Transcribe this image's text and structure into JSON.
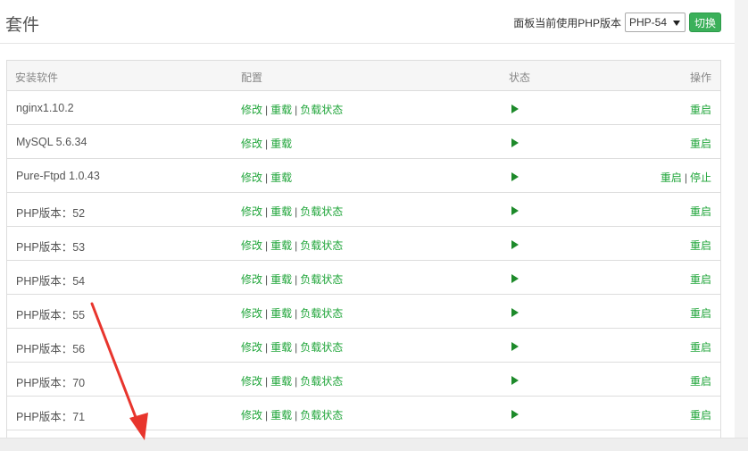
{
  "header": {
    "title": "套件",
    "php_label": "面板当前使用PHP版本",
    "php_selected": "PHP-54",
    "switch_label": "切换"
  },
  "table": {
    "columns": [
      "安装软件",
      "配置",
      "状态",
      "操作"
    ],
    "rows": [
      {
        "name": "nginx1.10.2",
        "config": [
          "修改",
          "重载",
          "负载状态"
        ],
        "ops": [
          "重启"
        ]
      },
      {
        "name": "MySQL 5.6.34",
        "config": [
          "修改",
          "重载"
        ],
        "ops": [
          "重启"
        ]
      },
      {
        "name": "Pure-Ftpd 1.0.43",
        "config": [
          "修改",
          "重载"
        ],
        "ops": [
          "重启",
          "停止"
        ]
      },
      {
        "name": "PHP版本：52",
        "config": [
          "修改",
          "重载",
          "负载状态"
        ],
        "ops": [
          "重启"
        ]
      },
      {
        "name": "PHP版本：53",
        "config": [
          "修改",
          "重载",
          "负载状态"
        ],
        "ops": [
          "重启"
        ]
      },
      {
        "name": "PHP版本：54",
        "config": [
          "修改",
          "重载",
          "负载状态"
        ],
        "ops": [
          "重启"
        ]
      },
      {
        "name": "PHP版本：55",
        "config": [
          "修改",
          "重载",
          "负载状态"
        ],
        "ops": [
          "重启"
        ]
      },
      {
        "name": "PHP版本：56",
        "config": [
          "修改",
          "重载",
          "负载状态"
        ],
        "ops": [
          "重启"
        ]
      },
      {
        "name": "PHP版本：70",
        "config": [
          "修改",
          "重载",
          "负载状态"
        ],
        "ops": [
          "重启"
        ]
      },
      {
        "name": "PHP版本：71",
        "config": [
          "修改",
          "重载",
          "负载状态"
        ],
        "ops": [
          "重启"
        ]
      }
    ]
  },
  "colors": {
    "link_green": "#20a53a",
    "button_green": "#3bb05a",
    "play_green": "#1d8a2a",
    "arrow_red": "#e8352d"
  },
  "icons": {
    "status": "play-icon",
    "select": "chevron-down-icon",
    "annotation": "red-arrow-annotation"
  }
}
